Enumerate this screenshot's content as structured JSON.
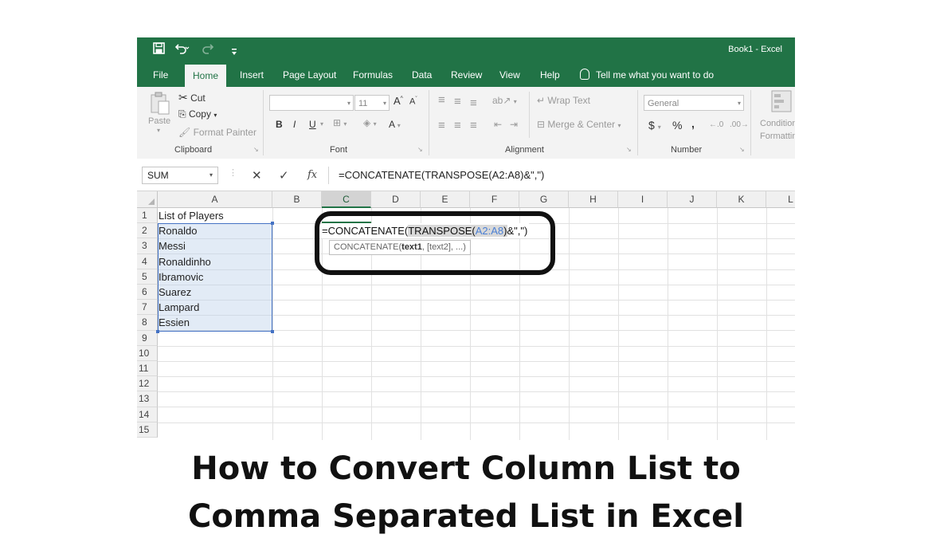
{
  "window": {
    "title": "Book1  -  Excel",
    "accent_color": "#217346"
  },
  "quick_access": {
    "save_icon": "save-icon",
    "undo_icon": "undo-icon",
    "redo_icon": "redo-icon",
    "customize_icon": "customize-qat-icon"
  },
  "ribbon_tabs": [
    "File",
    "Home",
    "Insert",
    "Page Layout",
    "Formulas",
    "Data",
    "Review",
    "View",
    "Help"
  ],
  "active_tab": "Home",
  "tell_me": "Tell me what you want to do",
  "ribbon": {
    "clipboard": {
      "label": "Clipboard",
      "paste": "Paste",
      "cut": "Cut",
      "copy": "Copy",
      "format_painter": "Format Painter"
    },
    "font": {
      "label": "Font",
      "size": "11",
      "bold": "B",
      "italic": "I",
      "underline": "U"
    },
    "alignment": {
      "label": "Alignment",
      "wrap_text": "Wrap Text",
      "merge_center": "Merge & Center"
    },
    "number": {
      "label": "Number",
      "format": "General",
      "currency": "$",
      "percent": "%",
      "comma": ","
    },
    "styles": {
      "conditional_formatting": "Conditional Formatting"
    }
  },
  "formula_bar": {
    "name_box": "SUM",
    "cancel": "✕",
    "enter": "✓",
    "fx": "fx",
    "formula": "=CONCATENATE(TRANSPOSE(A2:A8)&\",\")"
  },
  "columns": [
    "A",
    "B",
    "C",
    "D",
    "E",
    "F",
    "G",
    "H",
    "I",
    "J",
    "K",
    "L"
  ],
  "rows": [
    "1",
    "2",
    "3",
    "4",
    "5",
    "6",
    "7",
    "8",
    "9",
    "10",
    "11",
    "12",
    "13",
    "14",
    "15"
  ],
  "column_a": [
    "List of Players",
    "Ronaldo",
    "Messi",
    "Ronaldinho",
    "Ibramovic",
    "Suarez",
    "Lampard",
    "Essien"
  ],
  "editing_cell": {
    "part1": "=CONCATENATE(",
    "part2": "TRANSPOSE(",
    "ref": "A2:A8",
    "part3": ")",
    "part4": "&\",\")"
  },
  "tooltip": {
    "fn": "CONCATENATE(",
    "arg1": "text1",
    "rest": ", [text2], ...)"
  },
  "headline": {
    "line1": "How to Convert Column List to",
    "line2": "Comma Separated List in Excel"
  }
}
